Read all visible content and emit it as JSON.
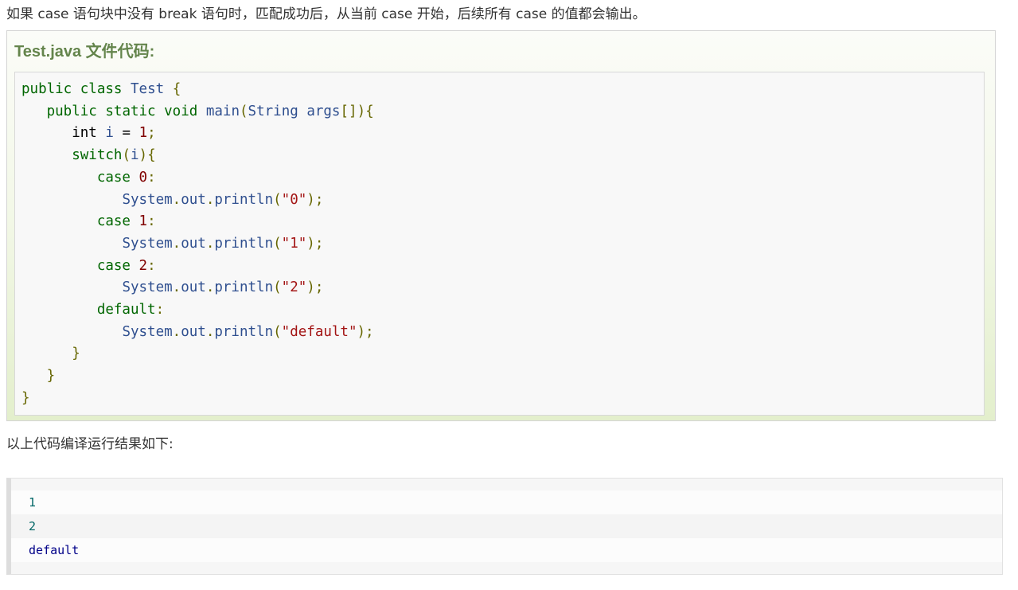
{
  "intro_text": "如果 case 语句块中没有 break 语句时，匹配成功后，从当前 case 开始，后续所有 case 的值都会输出。",
  "example": {
    "title": "Test.java 文件代码:",
    "code_lines": [
      "public class Test {",
      "   public static void main(String args[]){",
      "      int i = 1;",
      "      switch(i){",
      "         case 0:",
      "            System.out.println(\"0\");",
      "         case 1:",
      "            System.out.println(\"1\");",
      "         case 2:",
      "            System.out.println(\"2\");",
      "         default:",
      "            System.out.println(\"default\");",
      "      }",
      "   }",
      "}"
    ]
  },
  "result_label": "以上代码编译运行结果如下:",
  "output_lines": [
    "1",
    "2",
    "default"
  ],
  "colors": {
    "title_green": "#64854c",
    "keyword_green": "#006600",
    "identifier_blue": "#2f4f8f",
    "number_red": "#800000",
    "string_red": "#a31515",
    "punct_olive": "#666600"
  }
}
